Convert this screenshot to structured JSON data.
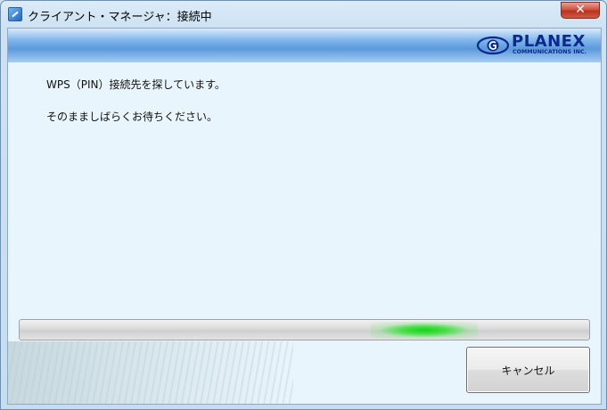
{
  "window": {
    "title": "クライアント・マネージャ：接続中",
    "close_glyph": "✕",
    "app_icon": "planex-app-icon",
    "close_icon": "close-icon"
  },
  "banner": {
    "logo_name": "PLANEX",
    "logo_sub": "COMMUNICATIONS INC.",
    "logo_icon": "planex-logo-icon"
  },
  "main": {
    "line1": "WPS（PIN）接続先を探しています。",
    "line2": "そのまましばらくお待ちください。"
  },
  "progress": {
    "style": "indeterminate-marquee",
    "accent_color": "#19d019",
    "highlight_fraction": 0.71
  },
  "buttons": {
    "cancel_label": "キャンセル"
  }
}
